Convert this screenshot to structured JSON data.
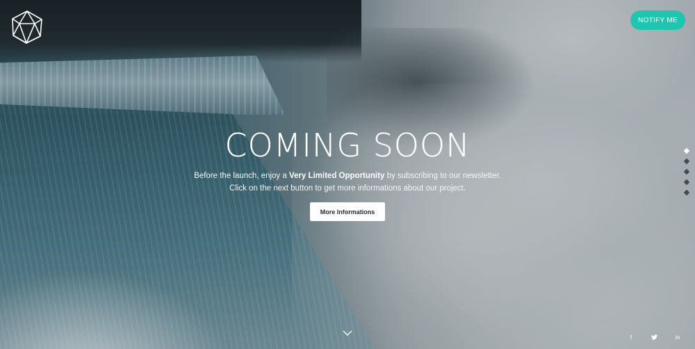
{
  "header": {
    "logo_icon": "geometric-polyhedron-icon",
    "notify_label": "NOTIFY ME",
    "accent_color": "#1ec6b0"
  },
  "hero": {
    "title": "COMING SOON",
    "line1_before": "Before the launch, enjoy a",
    "line1_bold": "Very Limited Opportunity",
    "line1_after": "by subscribing to our newsletter.",
    "line2": "Click on the next button to get more informations about our project.",
    "button_label": "More Informations"
  },
  "side_nav": {
    "items": [
      "slide-1",
      "slide-2",
      "slide-3",
      "slide-4",
      "slide-5"
    ],
    "active_index": 0
  },
  "scroll_indicator": {
    "icon": "chevron-down-icon"
  },
  "social": {
    "facebook": "f",
    "twitter": "twitter-bird-icon",
    "linkedin": "in"
  }
}
